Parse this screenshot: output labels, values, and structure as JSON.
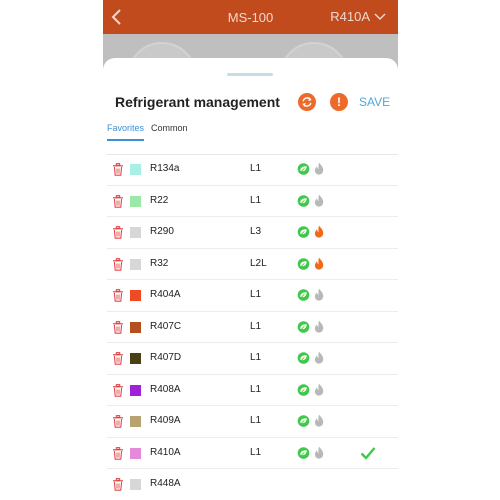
{
  "header": {
    "device_name": "MS-100",
    "selected_refrigerant": "R410A"
  },
  "sheet": {
    "title": "Refrigerant management",
    "save_label": "SAVE",
    "refresh_icon": "refresh-icon",
    "warning_icon": "warning-icon",
    "warning_glyph": "!",
    "tabs": [
      {
        "label": "Favorites",
        "active": true
      },
      {
        "label": "Common",
        "active": false
      }
    ]
  },
  "colors": {
    "header_bg": "#c24b1e",
    "accent_orange": "#ee6a2a",
    "save_blue": "#4aa9e0",
    "tab_active": "#3d8fd6",
    "trash_red": "#e04848",
    "eco_green": "#41c84a",
    "flame_gray": "#b8b8b8",
    "flame_orange": "#f06a1e",
    "check_green": "#41c84a"
  },
  "refrigerants": [
    {
      "name": "R134a",
      "safety_class": "L1",
      "swatch": "#a8f0e6",
      "flammable": false,
      "selected": false
    },
    {
      "name": "R22",
      "safety_class": "L1",
      "swatch": "#9be8a8",
      "flammable": false,
      "selected": false
    },
    {
      "name": "R290",
      "safety_class": "L3",
      "swatch": "#d5d8d7",
      "flammable": true,
      "selected": false
    },
    {
      "name": "R32",
      "safety_class": "L2L",
      "swatch": "#d5d8d7",
      "flammable": true,
      "selected": false
    },
    {
      "name": "R404A",
      "safety_class": "L1",
      "swatch": "#ee4a24",
      "flammable": false,
      "selected": false
    },
    {
      "name": "R407C",
      "safety_class": "L1",
      "swatch": "#b4501e",
      "flammable": false,
      "selected": false
    },
    {
      "name": "R407D",
      "safety_class": "L1",
      "swatch": "#4a4016",
      "flammable": false,
      "selected": false
    },
    {
      "name": "R408A",
      "safety_class": "L1",
      "swatch": "#a022d8",
      "flammable": false,
      "selected": false
    },
    {
      "name": "R409A",
      "safety_class": "L1",
      "swatch": "#b9a272",
      "flammable": false,
      "selected": false
    },
    {
      "name": "R410A",
      "safety_class": "L1",
      "swatch": "#e48ad8",
      "flammable": false,
      "selected": true
    },
    {
      "name": "R448A",
      "safety_class": "",
      "swatch": "#d5d8d7",
      "flammable": null,
      "selected": false
    }
  ]
}
